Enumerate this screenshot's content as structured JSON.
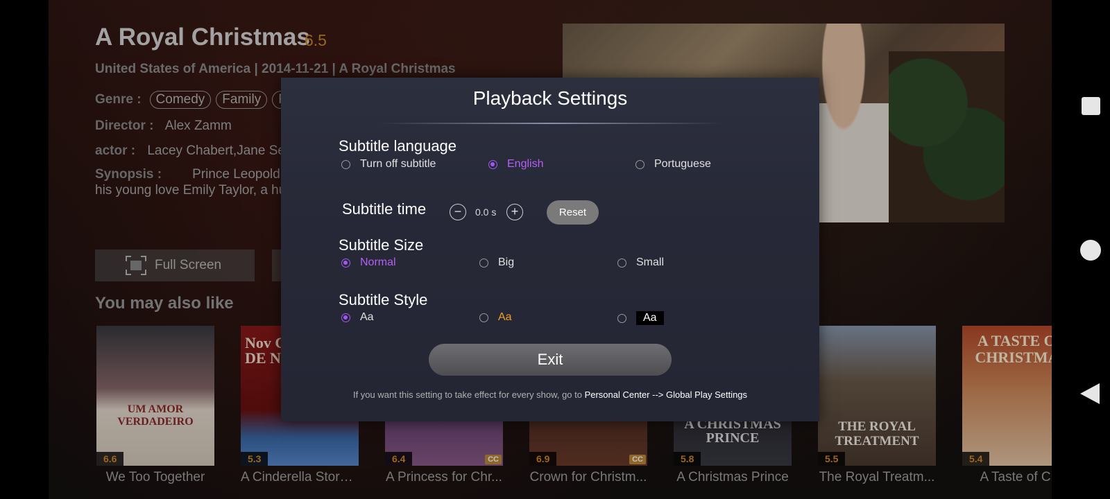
{
  "movie": {
    "title": "A Royal Christmas",
    "score": "6.5",
    "meta": "United States of America | 2014-11-21 | A Royal Christmas",
    "genre_key": "Genre :",
    "genres": [
      "Comedy",
      "Family",
      "R"
    ],
    "director_key": "Director :",
    "director": "Alex Zamm",
    "actor_key": "actor :",
    "actors": "Lacey Chabert,Jane Sey",
    "synopsis_key": "Synopsis :",
    "synopsis": "Prince Leopold",
    "synopsis_line2": "his young love Emily Taylor, a hu"
  },
  "actions": {
    "fullscreen_label": "Full Screen"
  },
  "recommendations": {
    "title": "You may also like",
    "items": [
      {
        "name": "We Too Together",
        "score": "6.6",
        "art_text": "UM AMOR VERDADEIRO",
        "cc": ""
      },
      {
        "name": "A Cinderella Story:...",
        "score": "5.3",
        "art_text": "Nov Cind MILA DE NA",
        "cc": ""
      },
      {
        "name": "A Princess for Chr...",
        "score": "6.4",
        "art_text": "",
        "cc": "CC"
      },
      {
        "name": "Crown for Christm...",
        "score": "6.9",
        "art_text": "",
        "cc": "CC"
      },
      {
        "name": "A Christmas Prince",
        "score": "5.8",
        "art_text": "A CHRISTMAS PRINCE",
        "cc": ""
      },
      {
        "name": "The Royal Treatm...",
        "score": "5.5",
        "art_text": "THE ROYAL TREATMENT",
        "cc": ""
      },
      {
        "name": "A Taste of Chr",
        "score": "5.4",
        "art_text": "A TASTE OF CHRISTMAS",
        "cc": ""
      }
    ]
  },
  "modal": {
    "title": "Playback Settings",
    "subtitle_language": {
      "label": "Subtitle language",
      "options": [
        "Turn off subtitle",
        "English",
        "Portuguese"
      ],
      "selected": "English"
    },
    "subtitle_time": {
      "label": "Subtitle time",
      "minus": "−",
      "plus": "+",
      "value": "0.0 s",
      "reset_label": "Reset"
    },
    "subtitle_size": {
      "label": "Subtitle Size",
      "options": [
        "Normal",
        "Big",
        "Small"
      ],
      "selected": "Normal"
    },
    "subtitle_style": {
      "label": "Subtitle Style",
      "options": [
        "Aa",
        "Aa",
        "Aa"
      ],
      "selected_index": 0
    },
    "exit_label": "Exit",
    "footer_prefix": "If you want this setting to take effect for every show, go to ",
    "footer_link": "Personal Center --> Global Play Settings"
  },
  "colors": {
    "accent": "#a357f0",
    "score": "#c8882a",
    "modal_bg": "#262837"
  }
}
